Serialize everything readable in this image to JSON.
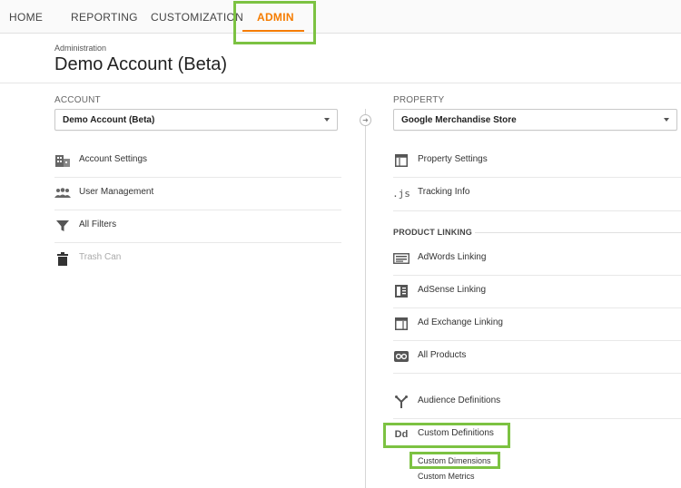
{
  "nav": {
    "home": "HOME",
    "reporting": "REPORTING",
    "customization": "CUSTOMIZATION",
    "admin": "ADMIN"
  },
  "header": {
    "breadcrumb": "Administration",
    "title": "Demo Account (Beta)"
  },
  "account": {
    "label": "ACCOUNT",
    "selected": "Demo Account (Beta)",
    "items": [
      {
        "label": "Account Settings",
        "icon": "building-icon"
      },
      {
        "label": "User Management",
        "icon": "users-icon"
      },
      {
        "label": "All Filters",
        "icon": "filter-icon"
      },
      {
        "label": "Trash Can",
        "icon": "trash-icon"
      }
    ]
  },
  "property": {
    "label": "PROPERTY",
    "selected": "Google Merchandise Store",
    "items": [
      {
        "label": "Property Settings",
        "icon": "window-icon"
      },
      {
        "label": "Tracking Info",
        "icon": "js-icon"
      }
    ],
    "product_linking": {
      "heading": "PRODUCT LINKING",
      "items": [
        {
          "label": "AdWords Linking",
          "icon": "adwords-icon"
        },
        {
          "label": "AdSense Linking",
          "icon": "adsense-icon"
        },
        {
          "label": "Ad Exchange Linking",
          "icon": "adexchange-icon"
        },
        {
          "label": "All Products",
          "icon": "infinity-icon"
        }
      ]
    },
    "more_items": [
      {
        "label": "Audience Definitions",
        "icon": "fork-icon"
      },
      {
        "label": "Custom Definitions",
        "icon": "dd-icon",
        "icon_text": "Dd"
      }
    ],
    "sub_items": [
      "Custom Dimensions",
      "Custom Metrics"
    ]
  },
  "colors": {
    "accent": "#f57c00",
    "highlight": "#7cc242"
  }
}
